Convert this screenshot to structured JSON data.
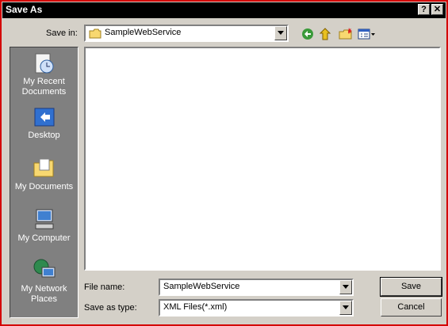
{
  "window": {
    "title": "Save As"
  },
  "title_buttons": {
    "help": "?",
    "close": "✕"
  },
  "toolbar": {
    "save_in_label": "Save in:",
    "save_in_value": "SampleWebService"
  },
  "places": [
    {
      "label": "My Recent Documents",
      "icon": "recent-documents-icon"
    },
    {
      "label": "Desktop",
      "icon": "desktop-icon"
    },
    {
      "label": "My Documents",
      "icon": "my-documents-icon"
    },
    {
      "label": "My Computer",
      "icon": "my-computer-icon"
    },
    {
      "label": "My Network Places",
      "icon": "network-places-icon"
    }
  ],
  "file_name": {
    "label": "File name:",
    "value": "SampleWebService"
  },
  "save_type": {
    "label": "Save as type:",
    "value": "XML Files(*.xml)"
  },
  "buttons": {
    "save": "Save",
    "cancel": "Cancel"
  },
  "colors": {
    "title_bar": "#000000",
    "border": "#d40000",
    "face": "#d4d0c8",
    "places_bg": "#808080"
  }
}
